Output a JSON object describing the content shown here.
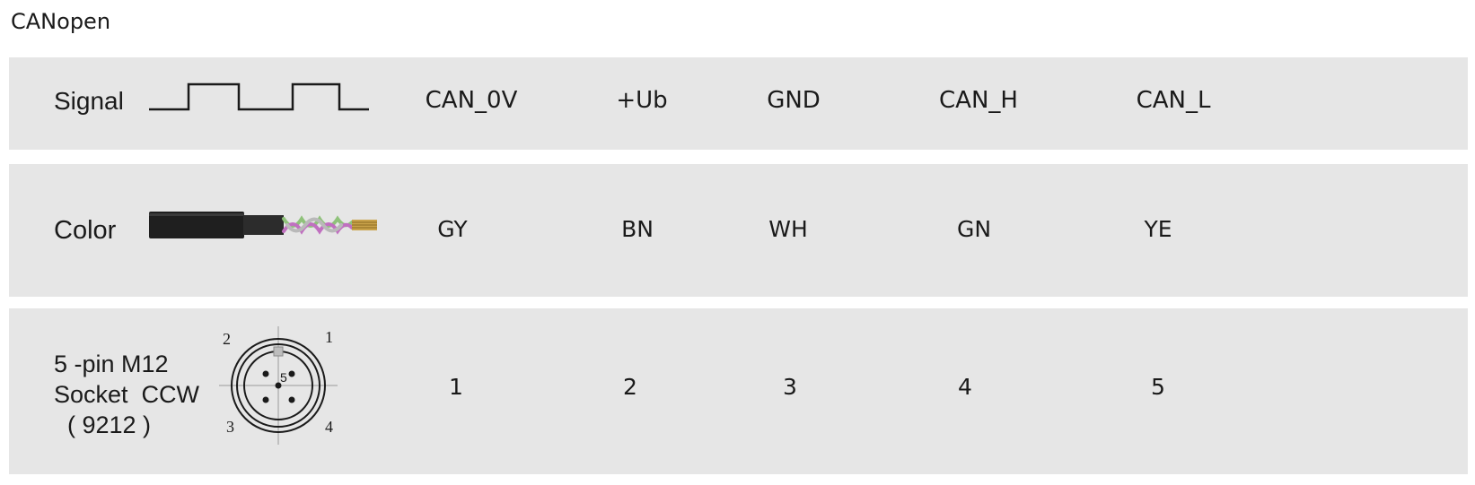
{
  "title": "CANopen",
  "rows": [
    {
      "label": "Signal",
      "values": [
        "CAN_0V",
        "+Ub",
        "GND",
        "CAN_H",
        "CAN_L"
      ]
    },
    {
      "label": "Color",
      "values": [
        "GY",
        "BN",
        "WH",
        "GN",
        "YE"
      ]
    },
    {
      "label": "5 -pin M12\nSocket  CCW\n  ( 9212 )",
      "values": [
        "1",
        "2",
        "3",
        "4",
        "5"
      ]
    }
  ],
  "connector_pins": [
    "1",
    "2",
    "3",
    "4",
    "5"
  ]
}
